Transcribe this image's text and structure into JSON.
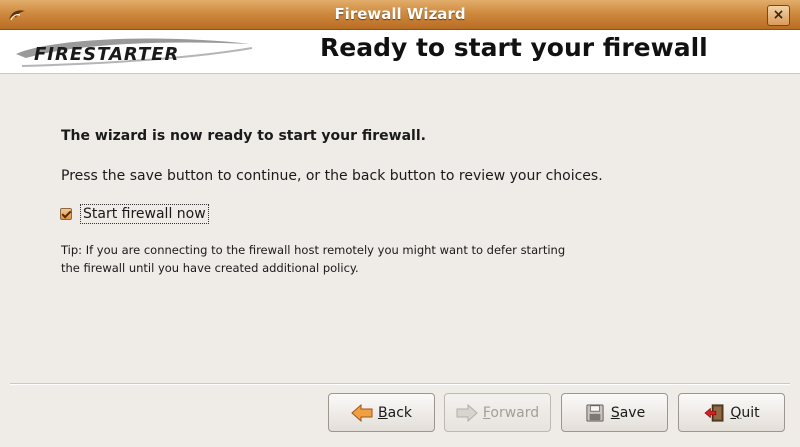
{
  "window": {
    "title": "Firewall Wizard",
    "close_glyph": "×",
    "app_icon": "firestarter-app-icon"
  },
  "header": {
    "logo_text": "FIRESTARTER",
    "page_title": "Ready to start your firewall"
  },
  "content": {
    "heading": "The wizard is now ready to start your firewall.",
    "instruction": "Press the save button to continue, or the back button to review your choices.",
    "checkbox_label": "Start firewall now",
    "checkbox_checked": true,
    "tip": "Tip: If you are connecting to the firewall host remotely you might want to defer starting the firewall until you have created additional policy."
  },
  "buttons": {
    "back": {
      "mnemonic": "B",
      "rest": "ack",
      "enabled": true,
      "icon": "arrow-left-icon"
    },
    "forward": {
      "mnemonic": "F",
      "rest": "orward",
      "enabled": false,
      "icon": "arrow-right-icon"
    },
    "save": {
      "mnemonic": "S",
      "rest": "ave",
      "enabled": true,
      "icon": "floppy-disk-icon"
    },
    "quit": {
      "mnemonic": "Q",
      "rest": "uit",
      "enabled": true,
      "icon": "exit-door-icon"
    }
  },
  "colors": {
    "titlebar": "#cf8a3f",
    "accent_orange": "#e09446",
    "window_bg": "#efebe7"
  }
}
